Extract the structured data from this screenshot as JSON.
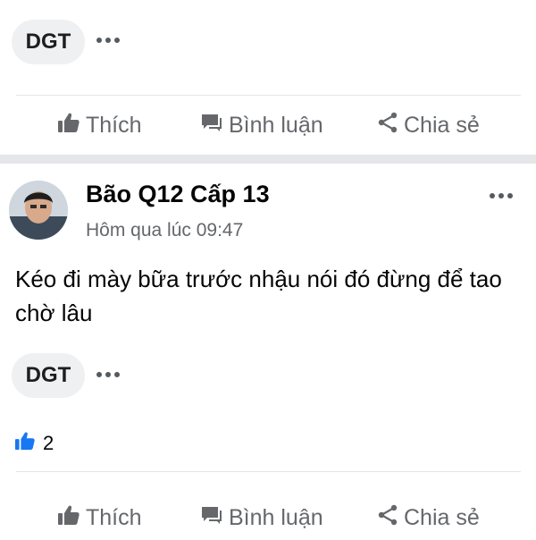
{
  "top_chip": {
    "label": "DGT"
  },
  "actions": {
    "like": "Thích",
    "comment": "Bình luận",
    "share": "Chia sẻ"
  },
  "post": {
    "author": "Bão Q12 Cấp 13",
    "time": "Hôm qua lúc 09:47",
    "text": "Kéo đi mày bữa trước nhậu nói đó đừng để tao chờ lâu",
    "chip": {
      "label": "DGT"
    },
    "like_count": "2"
  },
  "colors": {
    "like_blue": "#1877f2",
    "muted_text": "#65676b",
    "separator": "#e4e6e9"
  },
  "icons": {
    "like": "thumbs-up-icon",
    "comment": "comment-icon",
    "share": "share-icon",
    "more": "more-dots-icon"
  }
}
